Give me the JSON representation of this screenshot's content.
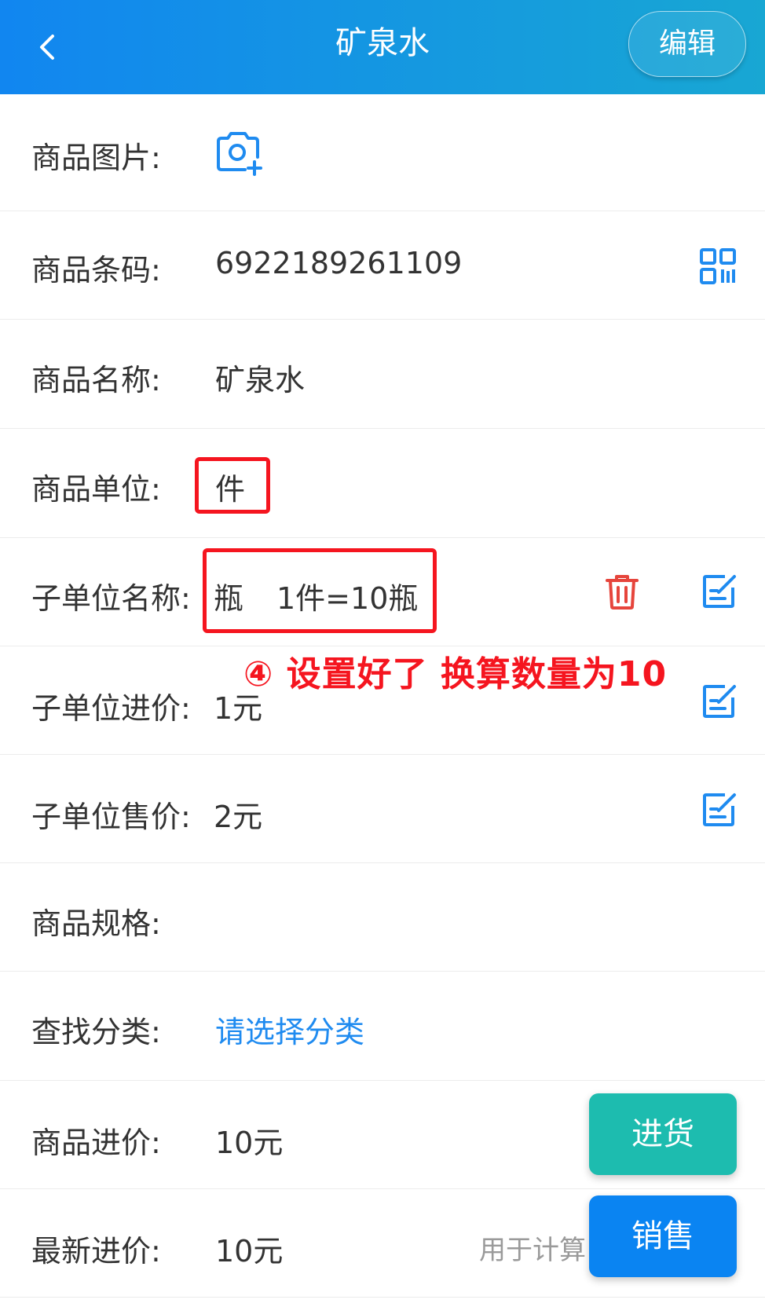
{
  "header": {
    "title": "矿泉水",
    "edit_label": "编辑"
  },
  "fields": {
    "image_label": "商品图片:",
    "barcode_label": "商品条码:",
    "barcode_value": "6922189261109",
    "name_label": "商品名称:",
    "name_value": "矿泉水",
    "unit_label": "商品单位:",
    "unit_value": "件",
    "subunit_name_label": "子单位名称:",
    "subunit_name_value": "瓶",
    "subunit_conversion": "1件=10瓶",
    "subunit_purchase_label": "子单位进价:",
    "subunit_purchase_value": "1元",
    "subunit_sale_label": "子单位售价:",
    "subunit_sale_value": "2元",
    "spec_label": "商品规格:",
    "category_label": "查找分类:",
    "category_value": "请选择分类",
    "purchase_price_label": "商品进价:",
    "purchase_price_value": "10元",
    "latest_price_label": "最新进价:",
    "latest_price_value": "10元",
    "latest_price_hint": "用于计算"
  },
  "annotation": {
    "text": "④ 设置好了 换算数量为10"
  },
  "actions": {
    "purchase_label": "进货",
    "sales_label": "销售"
  },
  "colors": {
    "header_start": "#1186f0",
    "header_end": "#18a7d3",
    "accent_blue": "#1f8bf0",
    "delete_red": "#e6453c",
    "annotation_red": "#f5151f",
    "purchase_button": "#1dbcaf",
    "sales_button": "#0a84f2"
  },
  "icons": {
    "back": "chevron-left-icon",
    "camera": "camera-add-icon",
    "scan": "qr-code-icon",
    "delete": "trash-icon",
    "edit": "edit-note-icon"
  }
}
